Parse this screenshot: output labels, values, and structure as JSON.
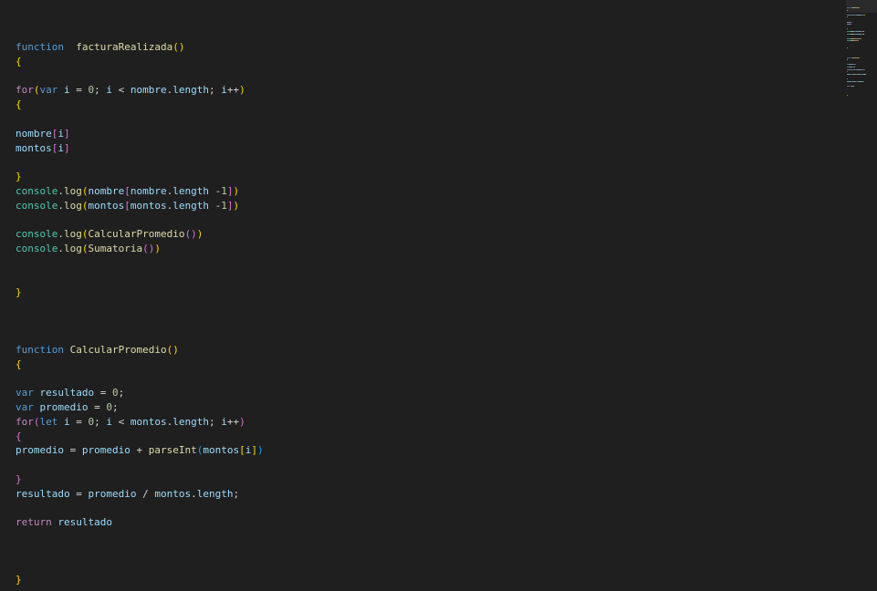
{
  "colors": {
    "background": "#1f1f1f",
    "keyword": "#569cd6",
    "control": "#c586c0",
    "function": "#dcdcaa",
    "variable": "#9cdcfe",
    "number": "#b5cea8",
    "class": "#4ec9b0"
  },
  "code_lines": [
    [
      [
        "function",
        "kw"
      ],
      [
        "  ",
        "op"
      ],
      [
        "facturaRealizada",
        "fn"
      ],
      [
        "()",
        "b1"
      ]
    ],
    [
      [
        "{",
        "b1"
      ]
    ],
    [],
    [
      [
        "for",
        "ctl"
      ],
      [
        "(",
        "b1"
      ],
      [
        "var",
        "kw"
      ],
      [
        " ",
        "op"
      ],
      [
        "i",
        "var"
      ],
      [
        " = ",
        "op"
      ],
      [
        "0",
        "num"
      ],
      [
        "; ",
        "op"
      ],
      [
        "i",
        "var"
      ],
      [
        " < ",
        "op"
      ],
      [
        "nombre",
        "var"
      ],
      [
        ".",
        "op"
      ],
      [
        "length",
        "var"
      ],
      [
        "; ",
        "op"
      ],
      [
        "i",
        "var"
      ],
      [
        "++",
        "op"
      ],
      [
        ")",
        "b1"
      ]
    ],
    [
      [
        "{",
        "b1"
      ]
    ],
    [],
    [
      [
        "nombre",
        "var"
      ],
      [
        "[",
        "b2"
      ],
      [
        "i",
        "var"
      ],
      [
        "]",
        "b2"
      ]
    ],
    [
      [
        "montos",
        "var"
      ],
      [
        "[",
        "b2"
      ],
      [
        "i",
        "var"
      ],
      [
        "]",
        "b2"
      ]
    ],
    [],
    [
      [
        "}",
        "b1"
      ]
    ],
    [
      [
        "console",
        "cls"
      ],
      [
        ".",
        "op"
      ],
      [
        "log",
        "fn"
      ],
      [
        "(",
        "b1"
      ],
      [
        "nombre",
        "var"
      ],
      [
        "[",
        "b2"
      ],
      [
        "nombre",
        "var"
      ],
      [
        ".",
        "op"
      ],
      [
        "length",
        "var"
      ],
      [
        " -",
        "op"
      ],
      [
        "1",
        "num"
      ],
      [
        "]",
        "b2"
      ],
      [
        ")",
        "b1"
      ]
    ],
    [
      [
        "console",
        "cls"
      ],
      [
        ".",
        "op"
      ],
      [
        "log",
        "fn"
      ],
      [
        "(",
        "b1"
      ],
      [
        "montos",
        "var"
      ],
      [
        "[",
        "b2"
      ],
      [
        "montos",
        "var"
      ],
      [
        ".",
        "op"
      ],
      [
        "length",
        "var"
      ],
      [
        " -",
        "op"
      ],
      [
        "1",
        "num"
      ],
      [
        "]",
        "b2"
      ],
      [
        ")",
        "b1"
      ]
    ],
    [],
    [
      [
        "console",
        "cls"
      ],
      [
        ".",
        "op"
      ],
      [
        "log",
        "fn"
      ],
      [
        "(",
        "b1"
      ],
      [
        "CalcularPromedio",
        "fn"
      ],
      [
        "()",
        "b2"
      ],
      [
        ")",
        "b1"
      ]
    ],
    [
      [
        "console",
        "cls"
      ],
      [
        ".",
        "op"
      ],
      [
        "log",
        "fn"
      ],
      [
        "(",
        "b1"
      ],
      [
        "Sumatoria",
        "fn"
      ],
      [
        "()",
        "b2"
      ],
      [
        ")",
        "b1"
      ]
    ],
    [],
    [],
    [
      [
        "}",
        "b1"
      ]
    ],
    [],
    [],
    [],
    [
      [
        "function",
        "kw"
      ],
      [
        " ",
        "op"
      ],
      [
        "CalcularPromedio",
        "fn"
      ],
      [
        "()",
        "b1"
      ]
    ],
    [
      [
        "{",
        "b1"
      ]
    ],
    [],
    [
      [
        "var",
        "kw"
      ],
      [
        " ",
        "op"
      ],
      [
        "resultado",
        "var"
      ],
      [
        " = ",
        "op"
      ],
      [
        "0",
        "num"
      ],
      [
        ";",
        "op"
      ]
    ],
    [
      [
        "var",
        "kw"
      ],
      [
        " ",
        "op"
      ],
      [
        "promedio",
        "var"
      ],
      [
        " = ",
        "op"
      ],
      [
        "0",
        "num"
      ],
      [
        ";",
        "op"
      ]
    ],
    [
      [
        "for",
        "ctl"
      ],
      [
        "(",
        "b2"
      ],
      [
        "let",
        "kw"
      ],
      [
        " ",
        "op"
      ],
      [
        "i",
        "var"
      ],
      [
        " = ",
        "op"
      ],
      [
        "0",
        "num"
      ],
      [
        "; ",
        "op"
      ],
      [
        "i",
        "var"
      ],
      [
        " < ",
        "op"
      ],
      [
        "montos",
        "var"
      ],
      [
        ".",
        "op"
      ],
      [
        "length",
        "var"
      ],
      [
        "; ",
        "op"
      ],
      [
        "i",
        "var"
      ],
      [
        "++",
        "op"
      ],
      [
        ")",
        "b2"
      ]
    ],
    [
      [
        "{",
        "b2"
      ]
    ],
    [
      [
        "promedio",
        "var"
      ],
      [
        " = ",
        "op"
      ],
      [
        "promedio",
        "var"
      ],
      [
        " + ",
        "op"
      ],
      [
        "parseInt",
        "fn"
      ],
      [
        "(",
        "b3"
      ],
      [
        "montos",
        "var"
      ],
      [
        "[",
        "b1"
      ],
      [
        "i",
        "var"
      ],
      [
        "]",
        "b1"
      ],
      [
        ")",
        "b3"
      ]
    ],
    [],
    [
      [
        "}",
        "b2"
      ]
    ],
    [
      [
        "resultado",
        "var"
      ],
      [
        " = ",
        "op"
      ],
      [
        "promedio",
        "var"
      ],
      [
        " / ",
        "op"
      ],
      [
        "montos",
        "var"
      ],
      [
        ".",
        "op"
      ],
      [
        "length",
        "var"
      ],
      [
        ";",
        "op"
      ]
    ],
    [],
    [
      [
        "return",
        "ctl"
      ],
      [
        " ",
        "op"
      ],
      [
        "resultado",
        "var"
      ]
    ],
    [],
    [],
    [],
    [
      [
        "}",
        "b1"
      ]
    ]
  ]
}
